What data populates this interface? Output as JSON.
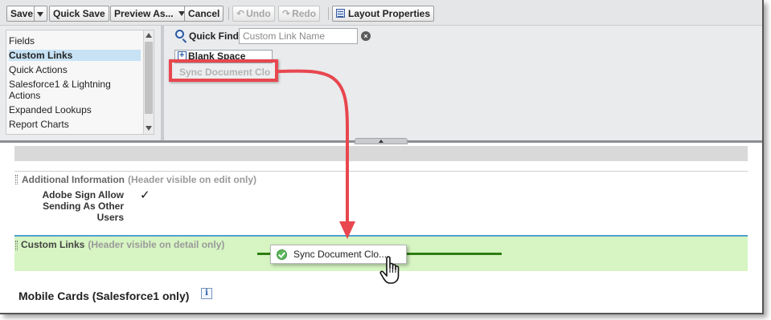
{
  "toolbar": {
    "save": "Save",
    "quick_save": "Quick Save",
    "preview_as": "Preview As...",
    "cancel": "Cancel",
    "undo": "Undo",
    "redo": "Redo",
    "layout_properties": "Layout Properties"
  },
  "categories": [
    {
      "label": "Fields",
      "selected": false
    },
    {
      "label": "Custom Links",
      "selected": true
    },
    {
      "label": "Quick Actions",
      "selected": false
    },
    {
      "label": "Salesforce1 & Lightning Actions",
      "selected": false
    },
    {
      "label": "Expanded Lookups",
      "selected": false
    },
    {
      "label": "Report Charts",
      "selected": false
    }
  ],
  "quick_find": {
    "label": "Quick Find",
    "placeholder": "Custom Link Name",
    "value": ""
  },
  "palette_items": {
    "blank_space": "Blank Space",
    "sync_document": "Sync Document Clo"
  },
  "sections": {
    "additional_information": {
      "title": "Additional Information",
      "note": "(Header visible on edit only)",
      "field_label": "Adobe Sign Allow Sending As Other Users",
      "field_value": "✓"
    },
    "custom_links": {
      "title": "Custom Links",
      "note": "(Header visible on detail only)"
    },
    "mobile_cards": {
      "title": "Mobile Cards (Salesforce1 only)"
    }
  },
  "drag_tile": {
    "label": "Sync Document Clo..."
  },
  "colors": {
    "callout_red": "#e8474f",
    "drop_zone_green": "#d6f5c2",
    "drop_line": "#2e7d12",
    "selected_category": "#c7e2f5"
  },
  "icons": [
    "quick-find-icon",
    "clear-search-icon",
    "blank-space-icon",
    "undo-icon",
    "redo-icon",
    "layout-properties-icon",
    "check-circle-icon",
    "hand-cursor-icon",
    "info-icon"
  ]
}
